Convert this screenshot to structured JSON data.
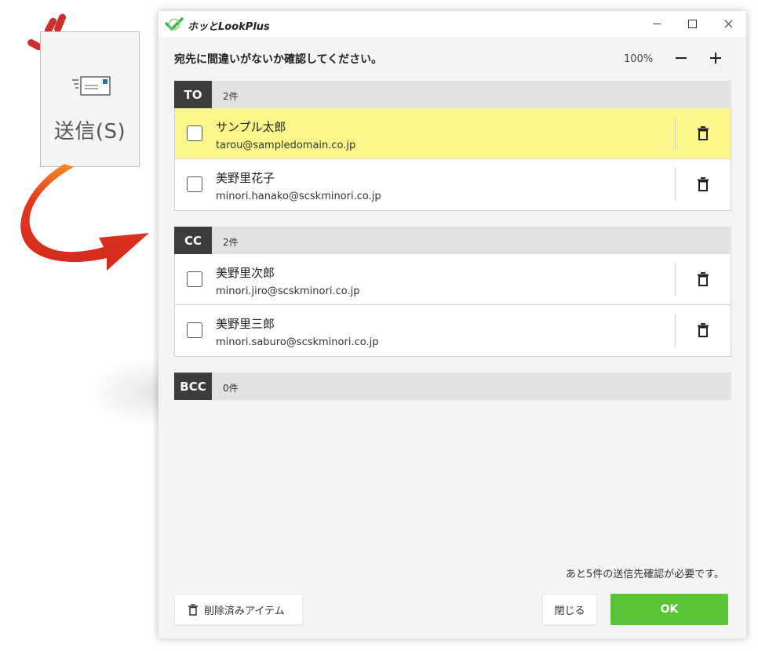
{
  "illustration": {
    "send_label": "送信(S)",
    "colors": {
      "arrow": "#d62a21",
      "arrow_highlight": "#f07f24"
    }
  },
  "window": {
    "app_title": "ホッとLookPlus",
    "controls": [
      "minimize",
      "maximize",
      "close"
    ]
  },
  "toolbar": {
    "instruction": "宛先に間違いがないか確認してください。",
    "zoom_value": "100%",
    "zoom_out_icon": "minus-icon",
    "zoom_in_icon": "plus-icon"
  },
  "sections": {
    "to": {
      "tag": "TO",
      "count": "2件",
      "rows": [
        {
          "name": "サンプル太郎",
          "email": "tarou@sampledomain.co.jp",
          "highlighted": true
        },
        {
          "name": "美野里花子",
          "email": "minori.hanako@scskminori.co.jp",
          "highlighted": false
        }
      ]
    },
    "cc": {
      "tag": "CC",
      "count": "2件",
      "rows": [
        {
          "name": "美野里次郎",
          "email": "minori.jiro@scskminori.co.jp",
          "highlighted": false
        },
        {
          "name": "美野里三郎",
          "email": "minori.saburo@scskminori.co.jp",
          "highlighted": false
        }
      ]
    },
    "bcc": {
      "tag": "BCC",
      "count": "0件",
      "rows": []
    }
  },
  "footer": {
    "remaining": "あと5件の送信先確認が必要です。",
    "deleted_items_label": "削除済みアイテム",
    "close_label": "閉じる",
    "ok_label": "OK"
  },
  "colors": {
    "ok_green": "#5ac437",
    "row_highlight": "#fbf68a",
    "tag_dark": "#3c3c3c",
    "logo_green": "#39b54a"
  }
}
